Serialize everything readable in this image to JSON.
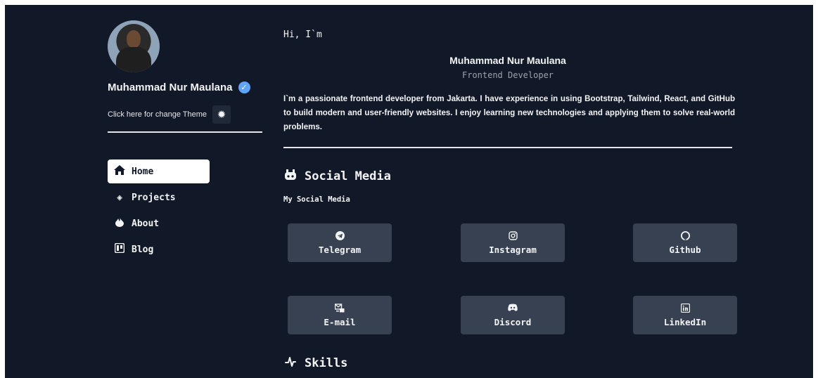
{
  "profile": {
    "name": "Muhammad Nur Maulana",
    "theme_label": "Click here for change Theme",
    "theme_icon": "gear-icon",
    "verified_icon": "verified-badge-icon"
  },
  "nav": {
    "items": [
      {
        "label": "Home",
        "icon": "home-icon",
        "active": true
      },
      {
        "label": "Projects",
        "icon": "layers-icon",
        "active": false
      },
      {
        "label": "About",
        "icon": "fire-icon",
        "active": false
      },
      {
        "label": "Blog",
        "icon": "board-icon",
        "active": false
      }
    ]
  },
  "hero": {
    "greeting": "Hi, I`m",
    "name": "Muhammad Nur Maulana",
    "role": "Frontend Developer",
    "bio": "I`m a passionate frontend developer from Jakarta. I have experience in using Bootstrap, Tailwind, React, and GitHub to build modern and user-friendly websites. I enjoy learning new technologies and applying them to solve real-world problems."
  },
  "social": {
    "title": "Social Media",
    "subtitle": "My Social Media",
    "items": [
      {
        "label": "Telegram",
        "icon": "telegram-icon"
      },
      {
        "label": "Instagram",
        "icon": "instagram-icon"
      },
      {
        "label": "Github",
        "icon": "github-icon"
      },
      {
        "label": "E-mail",
        "icon": "email-icon"
      },
      {
        "label": "Discord",
        "icon": "discord-icon"
      },
      {
        "label": "LinkedIn",
        "icon": "linkedin-icon"
      }
    ]
  },
  "skills": {
    "title": "Skills"
  },
  "colors": {
    "background": "#111827",
    "button": "#374151",
    "verified": "#60a5fa"
  }
}
